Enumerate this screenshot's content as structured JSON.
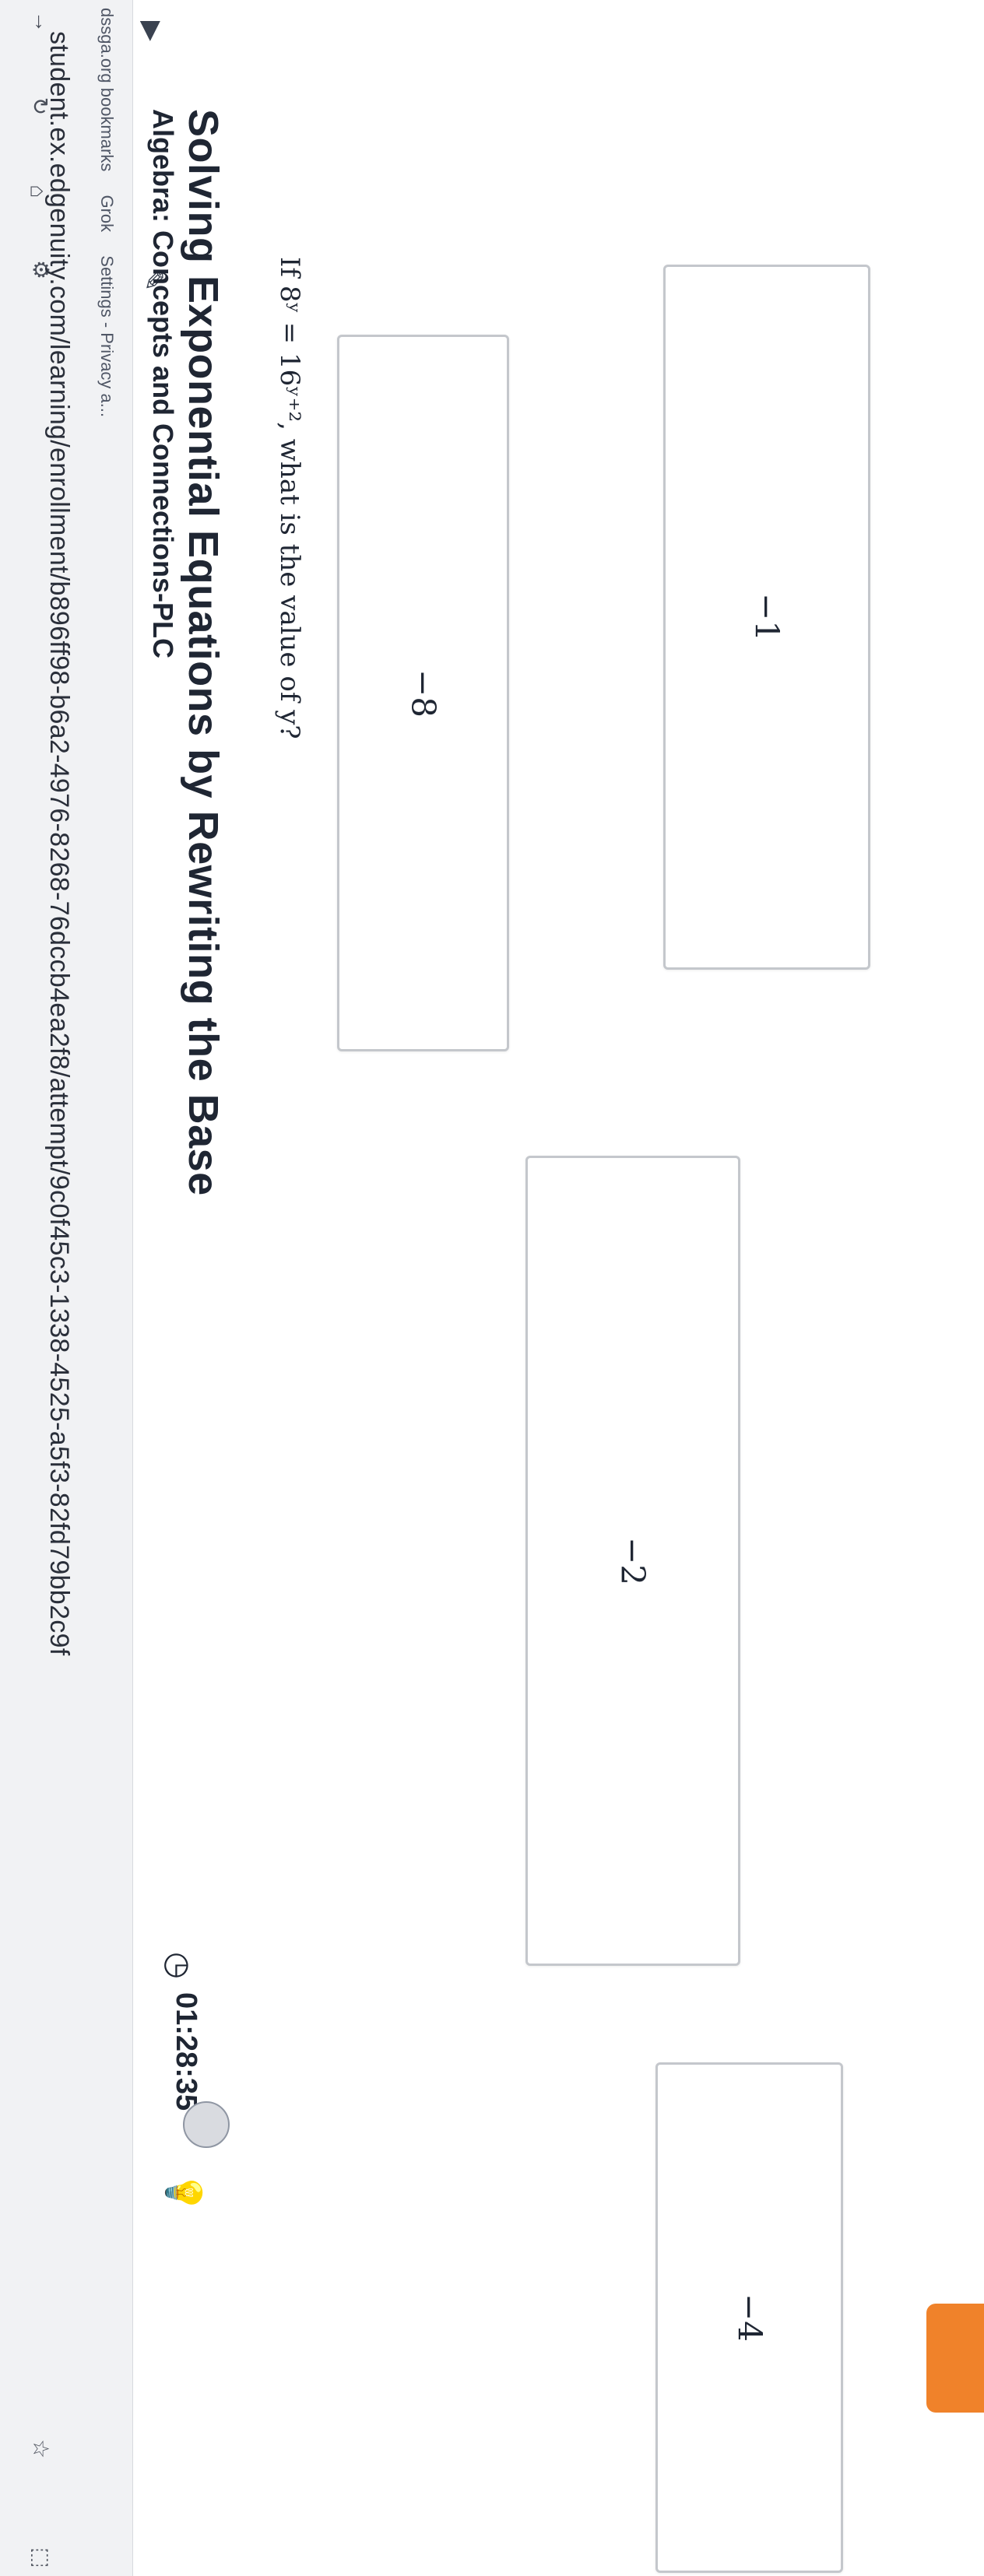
{
  "browser": {
    "url": "student.ex.edgenuity.com/learning/enrollment/b896ff98-b6a2-4976-8268-76dccb4ea2f8/attempt/9c0f45c3-1338-4525-a5f3-82fd79bb2c9f",
    "bookmarks": [
      "dssga.org bookmarks",
      "Grok",
      "Settings - Privacy a..."
    ]
  },
  "header": {
    "course": "Algebra: Concepts and Connections-PLC",
    "lesson_title": "Solving Exponential Equations by Rewriting the Base",
    "timer": "01:28:35"
  },
  "question": {
    "prefix": "If",
    "equation": "8ʸ = 16ʸ⁺²",
    "suffix": ", what is the value of y?"
  },
  "choices": [
    "−8",
    "−2",
    "−4",
    "−1"
  ]
}
